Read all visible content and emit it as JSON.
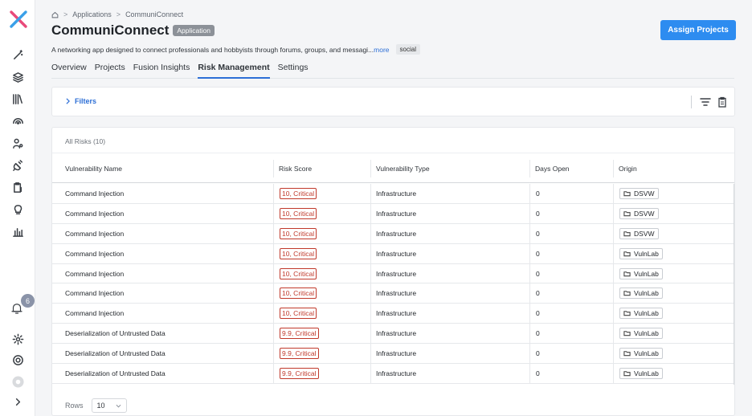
{
  "breadcrumb": {
    "items": [
      "Applications",
      "CommuniConnect"
    ]
  },
  "header": {
    "title": "CommuniConnect",
    "type_badge": "Application",
    "description": "A networking app designed to connect professionals and hobbyists through forums, groups, and messagi...",
    "more_link": "more",
    "tag": "social",
    "assign_button": "Assign Projects"
  },
  "tabs": [
    {
      "label": "Overview",
      "active": false
    },
    {
      "label": "Projects",
      "active": false
    },
    {
      "label": "Fusion Insights",
      "active": false
    },
    {
      "label": "Risk Management",
      "active": true
    },
    {
      "label": "Settings",
      "active": false
    }
  ],
  "filters": {
    "label": "Filters"
  },
  "table": {
    "summary": "All Risks (10)",
    "columns": [
      "Vulnerability Name",
      "Risk Score",
      "Vulnerability Type",
      "Days Open",
      "Origin"
    ],
    "rows": [
      {
        "name": "Command Injection",
        "score": "10, Critical",
        "type": "Infrastructure",
        "days": "0",
        "origin": "DSVW"
      },
      {
        "name": "Command Injection",
        "score": "10, Critical",
        "type": "Infrastructure",
        "days": "0",
        "origin": "DSVW"
      },
      {
        "name": "Command Injection",
        "score": "10, Critical",
        "type": "Infrastructure",
        "days": "0",
        "origin": "DSVW"
      },
      {
        "name": "Command Injection",
        "score": "10, Critical",
        "type": "Infrastructure",
        "days": "0",
        "origin": "VulnLab"
      },
      {
        "name": "Command Injection",
        "score": "10, Critical",
        "type": "Infrastructure",
        "days": "0",
        "origin": "VulnLab"
      },
      {
        "name": "Command Injection",
        "score": "10, Critical",
        "type": "Infrastructure",
        "days": "0",
        "origin": "VulnLab"
      },
      {
        "name": "Command Injection",
        "score": "10, Critical",
        "type": "Infrastructure",
        "days": "0",
        "origin": "VulnLab"
      },
      {
        "name": "Deserialization of Untrusted Data",
        "score": "9.9, Critical",
        "type": "Infrastructure",
        "days": "0",
        "origin": "VulnLab"
      },
      {
        "name": "Deserialization of Untrusted Data",
        "score": "9.9, Critical",
        "type": "Infrastructure",
        "days": "0",
        "origin": "VulnLab"
      },
      {
        "name": "Deserialization of Untrusted Data",
        "score": "9.9, Critical",
        "type": "Infrastructure",
        "days": "0",
        "origin": "VulnLab"
      }
    ]
  },
  "pagination": {
    "rows_label": "Rows",
    "rows_value": "10"
  },
  "sidebar": {
    "notification_count": "6"
  },
  "colors": {
    "accent": "#2d8cf0",
    "critical": "#c0392b",
    "logo_pink": "#e84a7a",
    "logo_blue": "#3aa0e8"
  }
}
